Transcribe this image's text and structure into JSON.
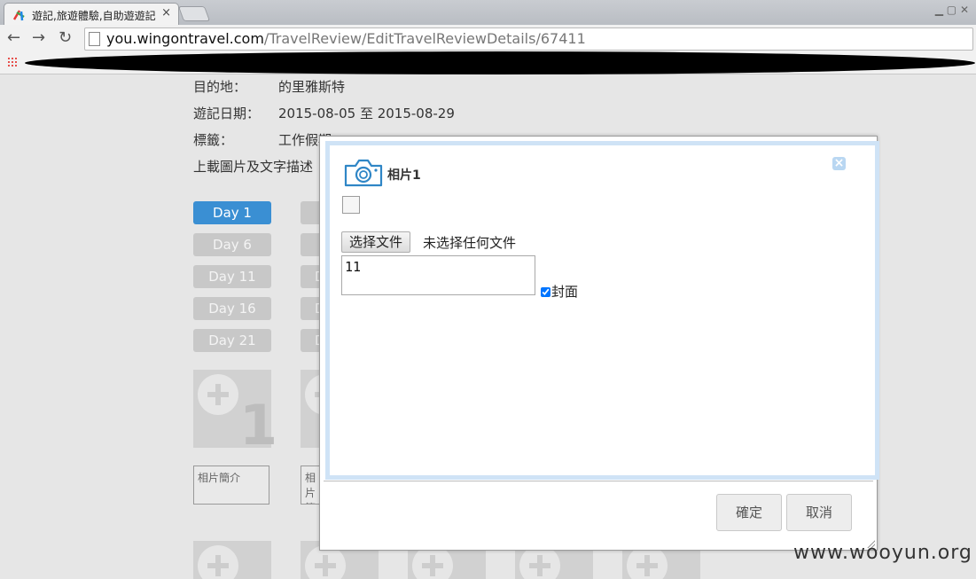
{
  "browser": {
    "tab_title": "遊記,旅遊體驗,自助遊遊記",
    "tab_close": "×",
    "url_host": "you.wingontravel.com",
    "url_path": "/TravelReview/EditTravelReviewDetails/67411"
  },
  "trip": {
    "destination_label": "目的地：",
    "destination_value": "的里雅斯特",
    "date_label": "遊記日期：",
    "date_value": "2015-08-05 至 2015-08-29",
    "tag_label": "標籤：",
    "tag_value": "工作假期",
    "upload_label": "上載圖片及文字描述"
  },
  "days": {
    "day1": "Day 1",
    "day6": "Day 6",
    "day11": "Day 11",
    "day16": "Day 16",
    "day21": "Day 21",
    "stub_letter": "D"
  },
  "photos": {
    "first_number": "1",
    "caption_placeholder": "相片簡介"
  },
  "modal": {
    "title": "相片1",
    "close_glyph": "×",
    "file_button": "选择文件",
    "file_status": "未选择任何文件",
    "description_value": "11",
    "cover_label": "封面",
    "cover_checked": true,
    "confirm_label": "確定",
    "cancel_label": "取消"
  },
  "watermark": "www.wooyun.org",
  "colors": {
    "active_day": "#3a8fd3",
    "inactive_day": "#c8c8c8",
    "modal_frame": "#cfe3f6",
    "camera_icon": "#2f86c6"
  }
}
